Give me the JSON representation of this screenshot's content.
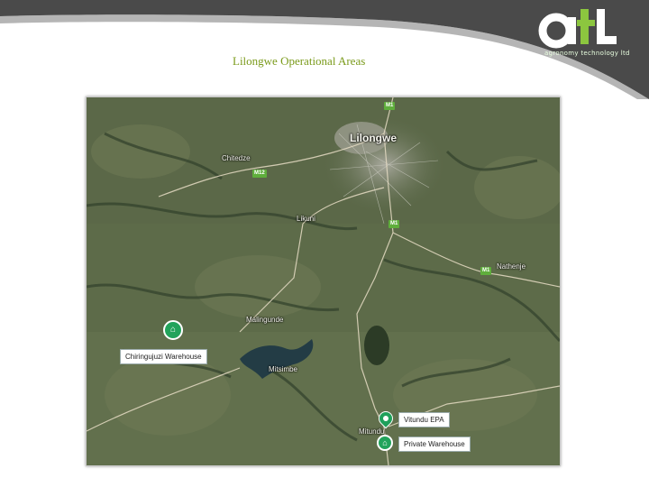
{
  "slide": {
    "title": "Lilongwe Operational Areas"
  },
  "logo": {
    "wordmark": "atl",
    "tagline": "agronomy technology ltd"
  },
  "colors": {
    "banner_dark": "#4a4a4a",
    "accent_green": "#7a9a1a",
    "marker_green": "#22a35b"
  },
  "map": {
    "places": {
      "lilongwe": "Lilongwe",
      "chitedze": "Chitedze",
      "likuni": "Likuni",
      "nathenje": "Nathenje",
      "malingunde": "Malingunde",
      "mitsimbe": "Mitsimbe",
      "mitundu": "Mitundu"
    },
    "roads": {
      "m1_north": "M1",
      "m12": "M12",
      "m1_mid": "M1",
      "m1_east": "M1"
    },
    "markers": {
      "chiringujuzi": "Chiringujuzi Warehouse",
      "vitundu": "Vitundu EPA",
      "private": "Private Warehouse"
    },
    "icons": {
      "warehouse": "home-icon",
      "epa": "map-pin-icon"
    }
  }
}
